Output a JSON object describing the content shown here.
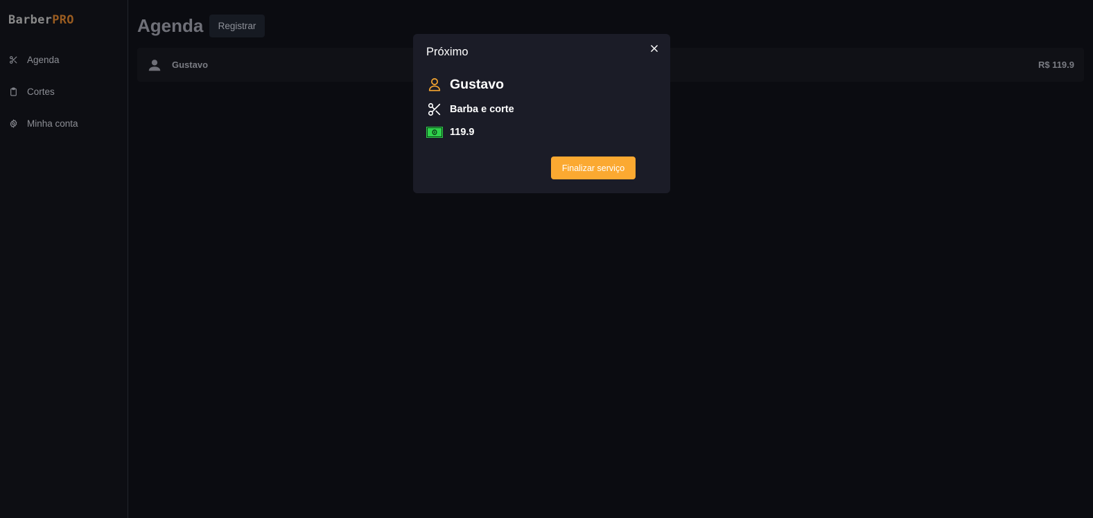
{
  "sidebar": {
    "logo_part1": "Barber",
    "logo_part2": "PRO",
    "items": [
      {
        "label": "Agenda",
        "icon": "scissors-icon"
      },
      {
        "label": "Cortes",
        "icon": "clipboard-icon"
      },
      {
        "label": "Minha conta",
        "icon": "gear-icon"
      }
    ]
  },
  "main": {
    "title": "Agenda",
    "register_label": "Registrar",
    "appointments": [
      {
        "name": "Gustavo",
        "price": "R$ 119.9"
      }
    ]
  },
  "modal": {
    "title": "Próximo",
    "client_name": "Gustavo",
    "service": "Barba e corte",
    "price": "119.9",
    "finish_label": "Finalizar serviço"
  },
  "colors": {
    "accent": "#fba931",
    "logo_accent": "#9a5c20",
    "modal_bg": "#1b1c27",
    "money_icon": "#2fd14b"
  }
}
